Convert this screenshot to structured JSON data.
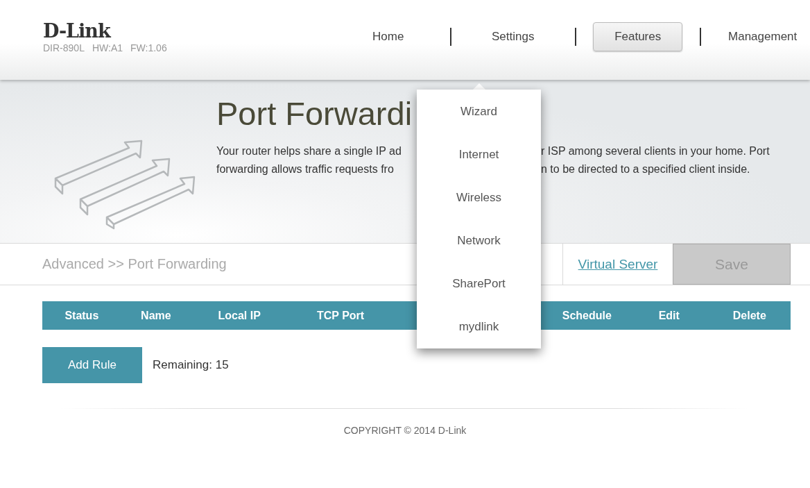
{
  "header": {
    "logo": "D-Link",
    "model": "DIR-890L",
    "hardware": "HW:A1",
    "firmware": "FW:1.06"
  },
  "nav": [
    {
      "label": "Home",
      "selected": false
    },
    {
      "label": "Settings",
      "selected": false
    },
    {
      "label": "Features",
      "selected": true
    },
    {
      "label": "Management",
      "selected": false
    }
  ],
  "dropdown": {
    "items": [
      "Wizard",
      "Internet",
      "Wireless",
      "Network",
      "SharePort",
      "mydlink"
    ]
  },
  "hero": {
    "title": "Port Forwardi",
    "description_lines": [
      {
        "left": "Your router helps share a single IP ad",
        "right": "r ISP among several clients in your home. Port"
      },
      {
        "left": "forwarding allows traffic requests fro",
        "right": "n to be directed to a specified client inside."
      }
    ]
  },
  "breadcrumb": "Advanced >> Port Forwarding",
  "link": "Virtual Server",
  "save": {
    "label": "Save",
    "disabled": true
  },
  "table": {
    "columns_left": [
      "Status",
      "Name",
      "Local IP",
      "TCP Port"
    ],
    "columns_right": [
      "Schedule",
      "Edit",
      "Delete"
    ]
  },
  "add_rule": "Add Rule",
  "remaining": "Remaining: 15",
  "footer": "COPYRIGHT © 2014 D-Link"
}
